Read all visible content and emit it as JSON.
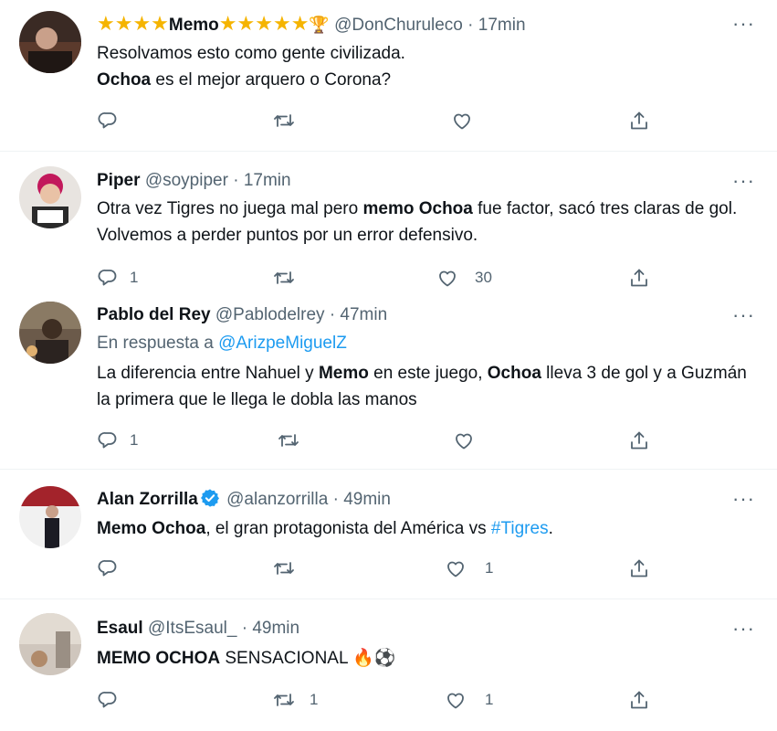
{
  "tweets": [
    {
      "name": "Memo",
      "stars_before": "★★★★",
      "stars_after": "★★★★★",
      "trophy": "🏆",
      "handle": "@DonChuruleco",
      "dot": "·",
      "time": "17min",
      "lines": [
        "Resolvamos esto como gente civilizada."
      ],
      "line2_bold": "Ochoa",
      "line2_rest": " es el mejor arquero o Corona?",
      "reply_count": "",
      "retweet_count": "",
      "like_count": ""
    },
    {
      "name": "Piper",
      "handle": "@soypiper",
      "dot": "·",
      "time": "17min",
      "text_a": "Otra vez Tigres no juega mal pero ",
      "text_bold": "memo Ochoa",
      "text_b": " fue factor, sacó tres claras de gol. Volvemos a perder puntos por un error defensivo.",
      "reply_count": "1",
      "retweet_count": "",
      "like_count": "30"
    },
    {
      "name": "Pablo del Rey",
      "handle": "@Pablodelrey",
      "dot": "·",
      "time": "47min",
      "reply_prefix": "En respuesta a ",
      "reply_to": "@ArizpeMiguelZ",
      "text_a": "La diferencia entre Nahuel y ",
      "text_bold1": "Memo",
      "text_b": " en este juego, ",
      "text_bold2": "Ochoa",
      "text_c": " lleva 3 de gol y a Guzmán la primera que le llega le dobla las manos",
      "reply_count": "1",
      "retweet_count": "",
      "like_count": ""
    },
    {
      "name": "Alan Zorrilla",
      "handle": "@alanzorrilla",
      "dot": "·",
      "time": "49min",
      "text_bold": "Memo Ochoa",
      "text_a": ", el gran protagonista del América vs ",
      "hashtag": "#Tigres",
      "text_b": ".",
      "reply_count": "",
      "retweet_count": "",
      "like_count": "1"
    },
    {
      "name": "Esaul",
      "handle": "@ItsEsaul_",
      "dot": "·",
      "time": "49min",
      "text_bold": "MEMO OCHOA",
      "text_a": " SENSACIONAL ",
      "emoji": "🔥⚽",
      "reply_count": "",
      "retweet_count": "1",
      "like_count": "1"
    }
  ],
  "more_label": "···",
  "colors": {
    "accent": "#1d9bf0",
    "secondary_text": "#536471",
    "separator": "#eff3f4",
    "star": "#f5b400"
  },
  "icons": [
    "reply-icon",
    "retweet-icon",
    "like-icon",
    "share-icon",
    "more-icon",
    "verified-badge-icon"
  ]
}
